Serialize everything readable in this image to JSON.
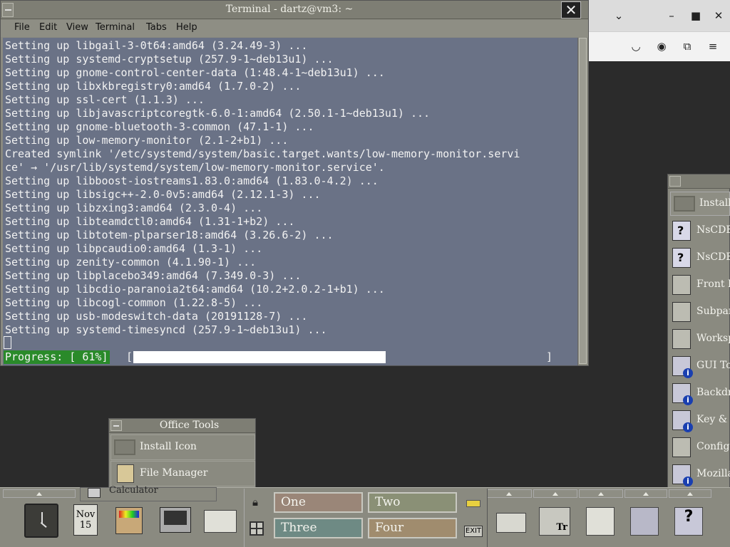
{
  "browser": {
    "icons": [
      "chevron-down-icon",
      "minimize-icon",
      "maximize-icon",
      "close-icon",
      "pocket-icon",
      "account-icon",
      "extensions-icon",
      "menu-icon"
    ]
  },
  "terminal": {
    "title": "Terminal - dartz@vm3: ~",
    "menu": [
      "File",
      "Edit",
      "View",
      "Terminal",
      "Tabs",
      "Help"
    ],
    "lines": [
      "Setting up libgail-3-0t64:amd64 (3.24.49-3) ...",
      "Setting up systemd-cryptsetup (257.9-1~deb13u1) ...",
      "Setting up gnome-control-center-data (1:48.4-1~deb13u1) ...",
      "Setting up libxkbregistry0:amd64 (1.7.0-2) ...",
      "Setting up ssl-cert (1.1.3) ...",
      "Setting up libjavascriptcoregtk-6.0-1:amd64 (2.50.1-1~deb13u1) ...",
      "Setting up gnome-bluetooth-3-common (47.1-1) ...",
      "Setting up low-memory-monitor (2.1-2+b1) ...",
      "Created symlink '/etc/systemd/system/basic.target.wants/low-memory-monitor.servi",
      "ce' → '/usr/lib/systemd/system/low-memory-monitor.service'.",
      "Setting up libboost-iostreams1.83.0:amd64 (1.83.0-4.2) ...",
      "Setting up libsigc++-2.0-0v5:amd64 (2.12.1-3) ...",
      "Setting up libzxing3:amd64 (2.3.0-4) ...",
      "Setting up libteamdctl0:amd64 (1.31-1+b2) ...",
      "Setting up libtotem-plparser18:amd64 (3.26.6-2) ...",
      "Setting up libpcaudio0:amd64 (1.3-1) ...",
      "Setting up zenity-common (4.1.90-1) ...",
      "Setting up libplacebo349:amd64 (7.349.0-3) ...",
      "Setting up libcdio-paranoia2t64:amd64 (10.2+2.0.2-1+b1) ...",
      "Setting up libcogl-common (1.22.8-5) ...",
      "Setting up usb-modeswitch-data (20191128-7) ...",
      "Setting up systemd-timesyncd (257.9-1~deb13u1) ..."
    ],
    "progress_label": "Progress: [ 61%]",
    "progress_left_bracket": "[",
    "progress_right_bracket": "]",
    "progress_fraction": 0.61
  },
  "right_panel": {
    "install_label": "Install",
    "items": [
      "NsCDE",
      "NsCDE",
      "Front P",
      "Subpan",
      "Worksp",
      "GUI To",
      "Backdr",
      "Key &",
      "Config",
      "Mozilla"
    ]
  },
  "office_tools": {
    "title": "Office Tools",
    "install_label": "Install Icon",
    "file_manager_label": "File Manager",
    "calculator_label": "Calculator"
  },
  "front_panel": {
    "calendar_month": "Nov",
    "calendar_day": "15",
    "workspaces": [
      "One",
      "Two",
      "Three",
      "Four"
    ],
    "exit_label": "EXIT",
    "style_label": "Tr"
  }
}
